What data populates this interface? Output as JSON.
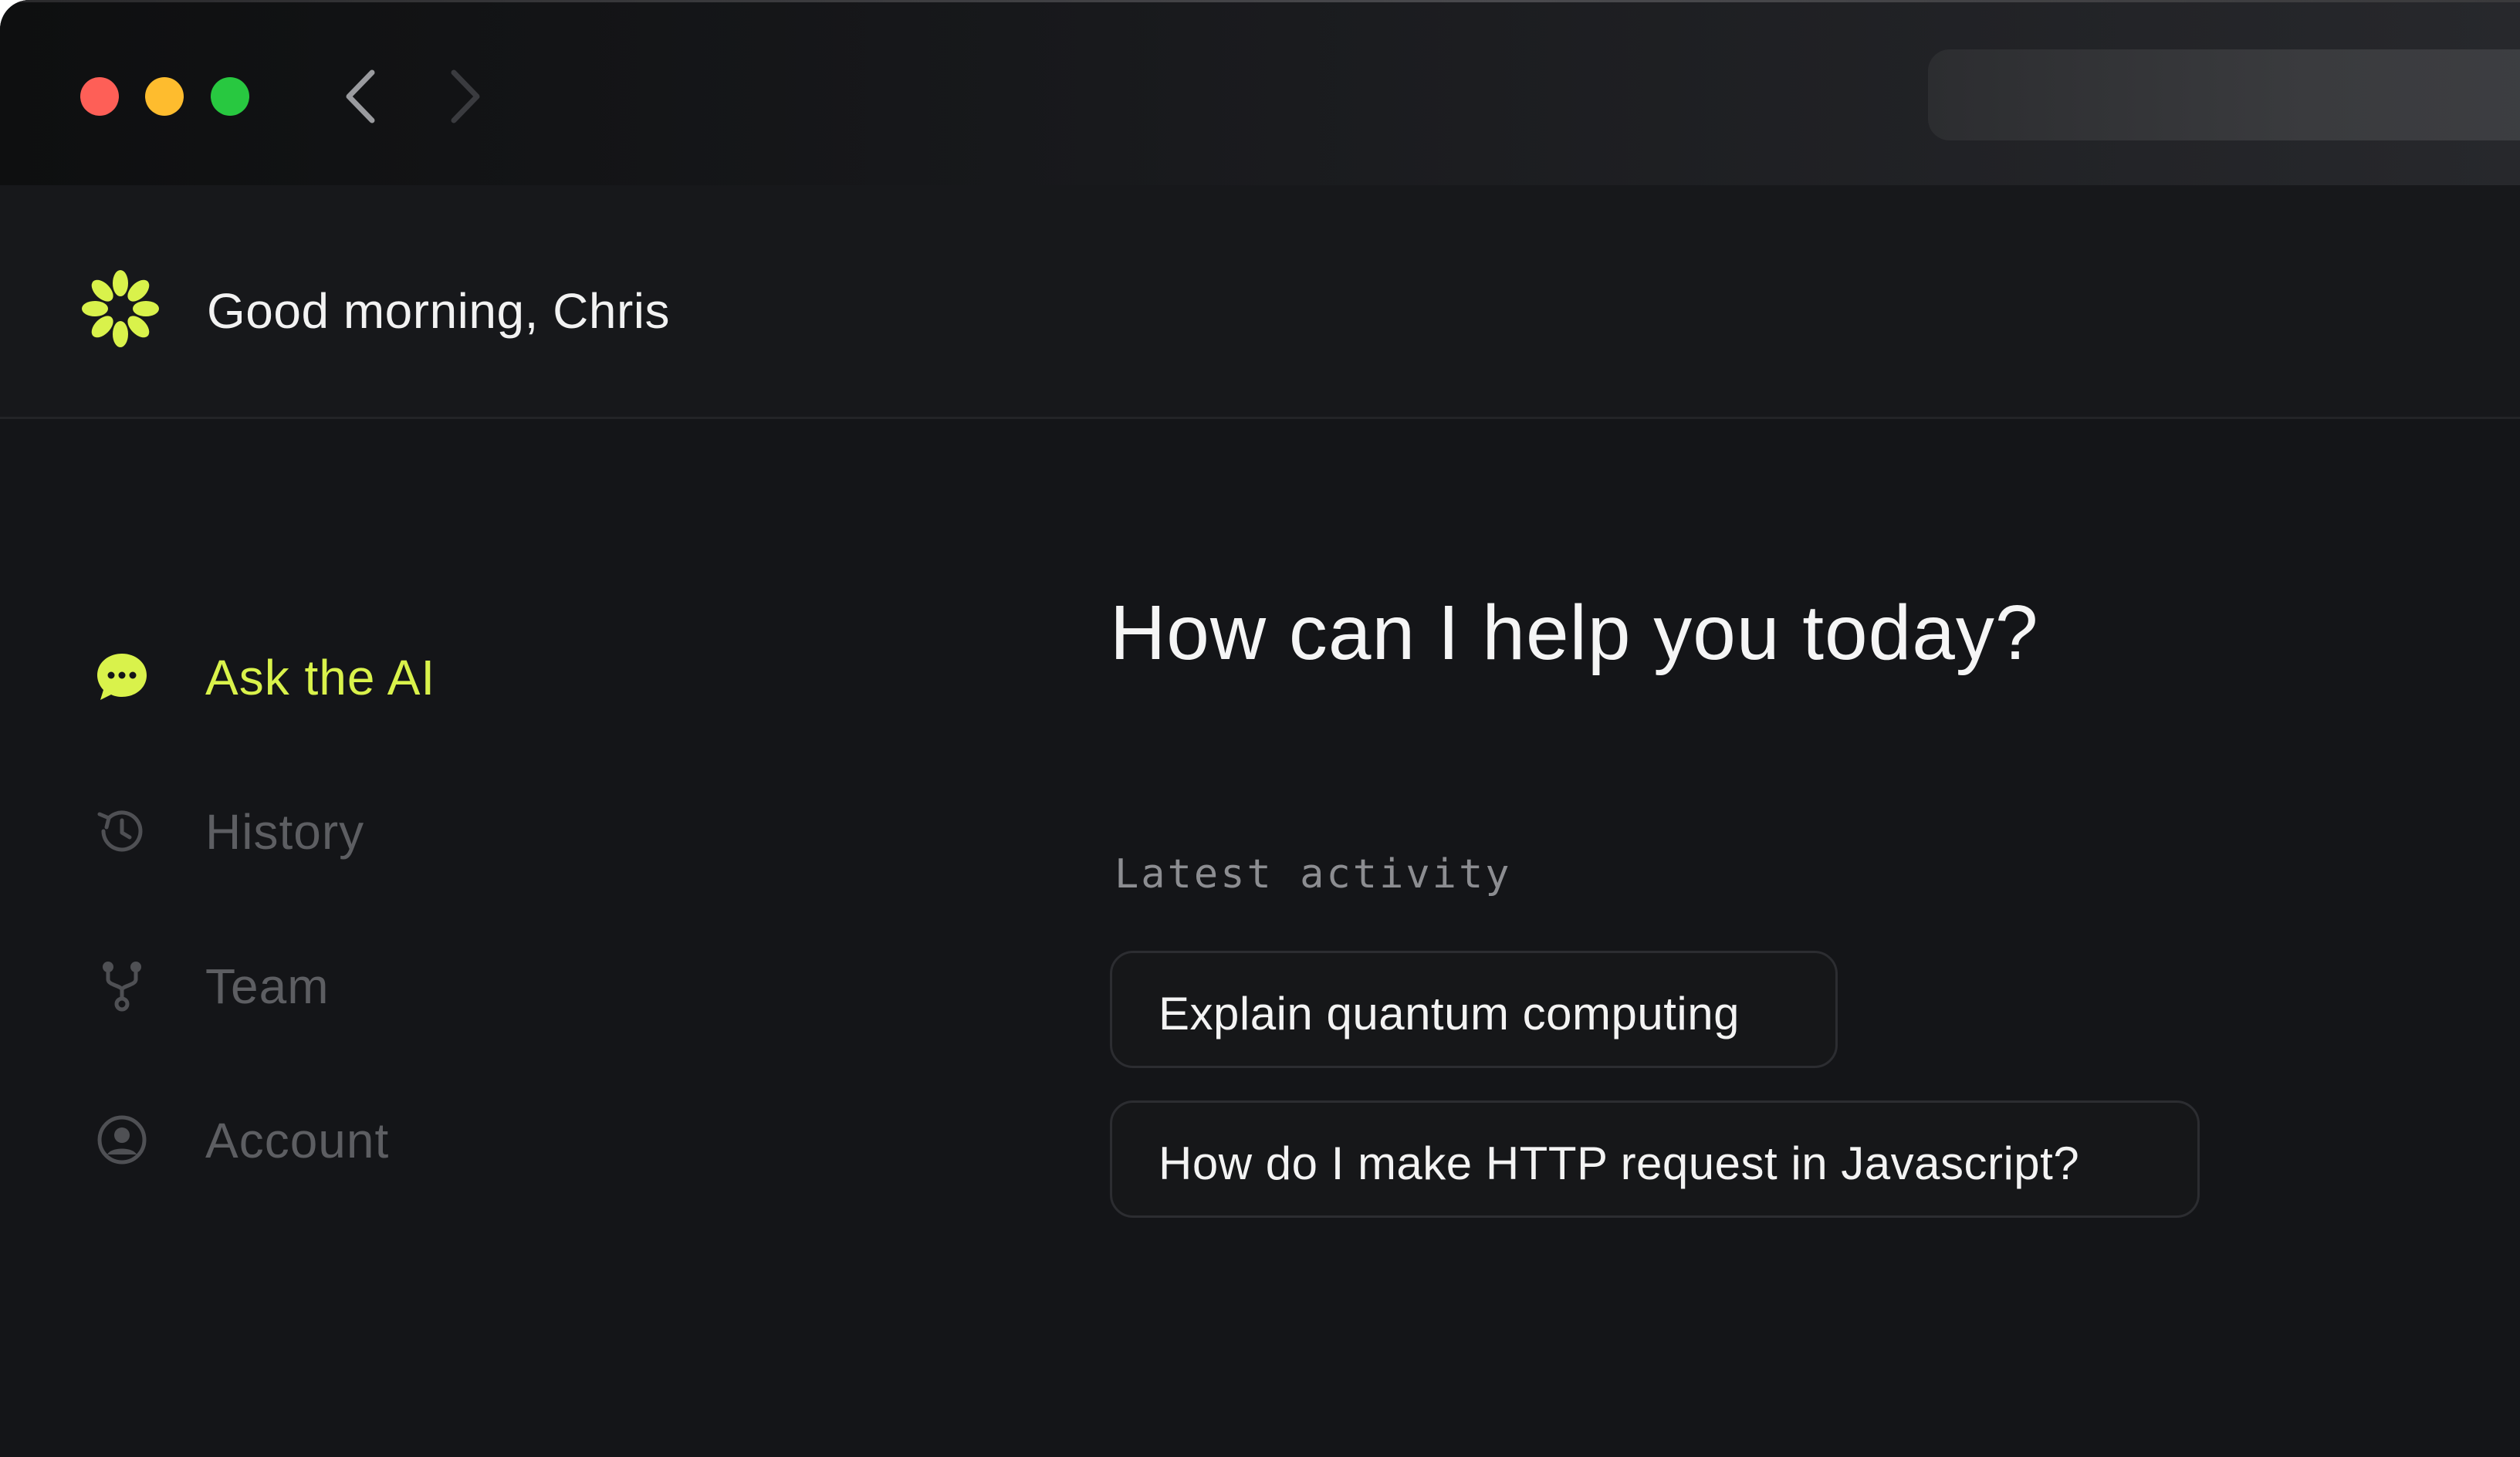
{
  "header": {
    "greeting": "Good morning, Chris",
    "logo_icon": "flower-icon"
  },
  "sidebar": {
    "items": [
      {
        "label": "Ask the AI",
        "icon": "chat-bubble-icon",
        "active": true
      },
      {
        "label": "History",
        "icon": "history-icon",
        "active": false
      },
      {
        "label": "Team",
        "icon": "fork-icon",
        "active": false
      },
      {
        "label": "Account",
        "icon": "user-circle-icon",
        "active": false
      }
    ]
  },
  "main": {
    "question": "How can I help you today?",
    "latest_activity_label": "Latest activity",
    "activity": [
      {
        "label": "Explain quantum computing"
      },
      {
        "label": "How do I make HTTP request in Javascript?"
      }
    ]
  },
  "colors": {
    "accent": "#d9f24b",
    "background": "#141518",
    "header_background": "#17181b",
    "text_primary": "#f2f2f2",
    "text_muted": "#5d5e62",
    "traffic_red": "#fe5f57",
    "traffic_yellow": "#febc2e",
    "traffic_green": "#28c840"
  }
}
